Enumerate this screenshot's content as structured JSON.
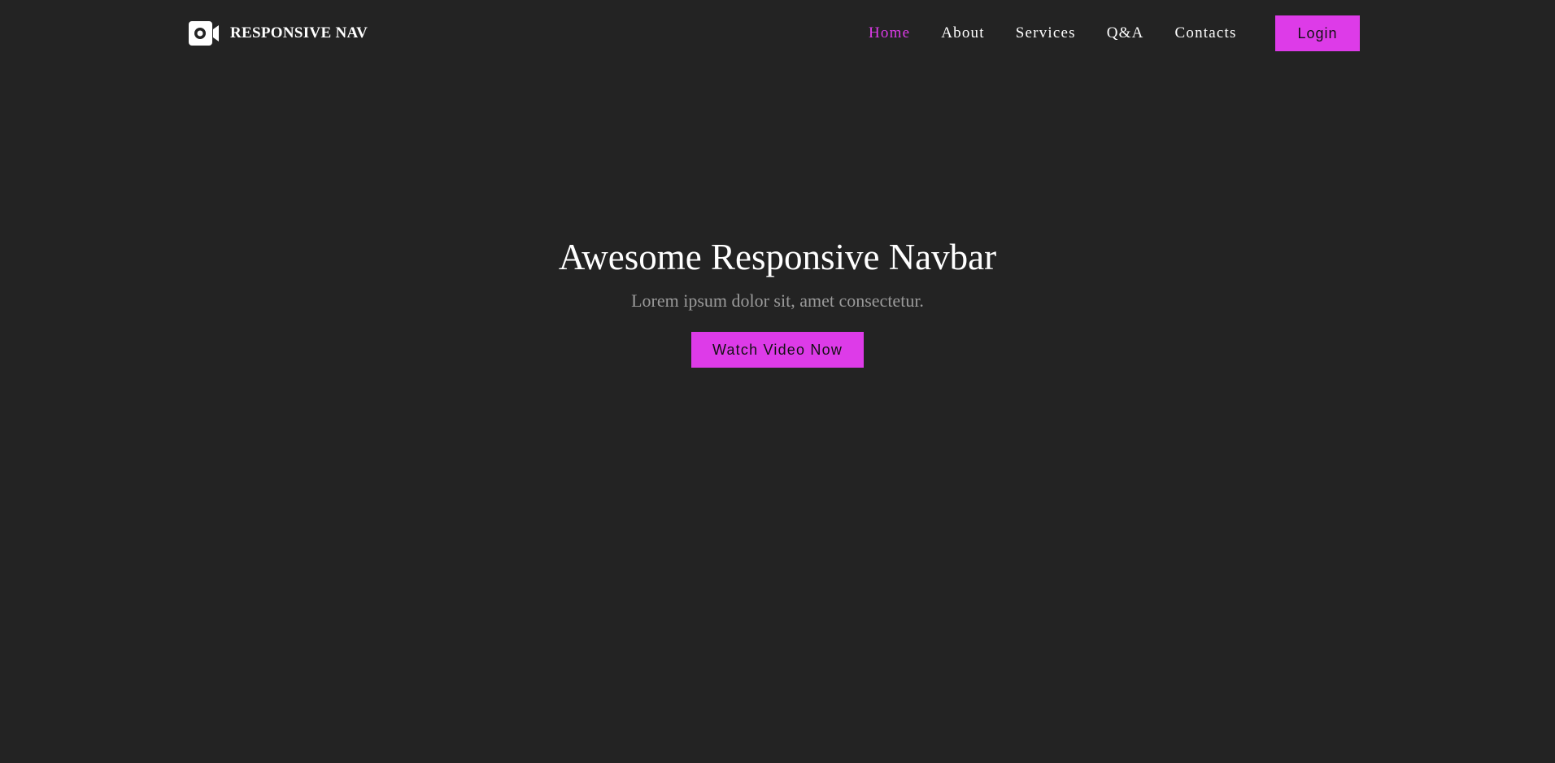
{
  "brand": {
    "name": "RESPONSIVE NAV",
    "icon": "video-camera-icon"
  },
  "nav": {
    "links": [
      {
        "label": "Home",
        "active": true
      },
      {
        "label": "About",
        "active": false
      },
      {
        "label": "Services",
        "active": false
      },
      {
        "label": "Q&A",
        "active": false
      },
      {
        "label": "Contacts",
        "active": false
      }
    ],
    "login_label": "Login"
  },
  "hero": {
    "title": "Awesome Responsive Navbar",
    "subtitle": "Lorem ipsum dolor sit, amet consectetur.",
    "cta_label": "Watch Video Now"
  },
  "colors": {
    "accent": "#dd3be8",
    "background": "#232323",
    "text": "#ffffff",
    "muted": "#9a9a9a"
  }
}
